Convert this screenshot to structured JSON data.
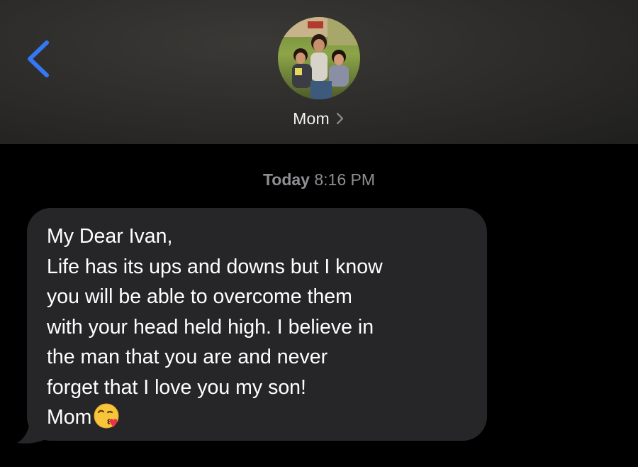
{
  "header": {
    "contact_name": "Mom",
    "avatar_description": "group-photo-avatar"
  },
  "conversation": {
    "timestamp_day": "Today",
    "timestamp_time": "8:16 PM",
    "message": {
      "lines": [
        "My Dear Ivan,",
        "Life has its ups and downs but I know",
        "you will be able to overcome them",
        "with your head held high. I believe in",
        "the man that you are and never",
        "forget that I love you my son!",
        "Mom"
      ],
      "emoji": "kissing-face-with-heart-emoji"
    }
  },
  "colors": {
    "accent": "#3478f6",
    "bubble": "#262629",
    "background": "#000000",
    "timestamp": "#8e8e93"
  }
}
